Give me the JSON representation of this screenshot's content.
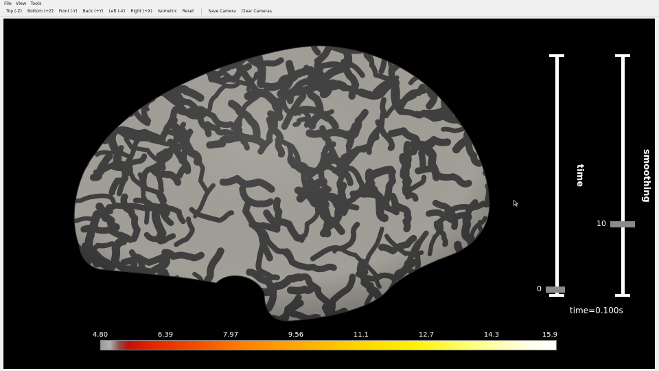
{
  "menu": [
    "File",
    "View",
    "Tools"
  ],
  "toolbar": {
    "views": [
      "Top (-Z)",
      "Bottom (+Z)",
      "Front (-Y)",
      "Back (+Y)",
      "Left (-X)",
      "Right (+X)",
      "Isometric",
      "Reset"
    ],
    "cameras": [
      "Save Camera",
      "Clear Cameras"
    ]
  },
  "sliders": {
    "time": {
      "title": "time",
      "value": "0"
    },
    "smoothing": {
      "title": "smoothing",
      "value": "10"
    }
  },
  "time_label": "time=0.100s",
  "colorbar": {
    "ticks": [
      "4.80",
      "6.39",
      "7.97",
      "9.56",
      "11.1",
      "12.7",
      "14.3",
      "15.9"
    ]
  },
  "colors": {
    "background": "#000000",
    "surface_gyri": "#a29f98",
    "surface_sulci": "#3f3f3f"
  }
}
